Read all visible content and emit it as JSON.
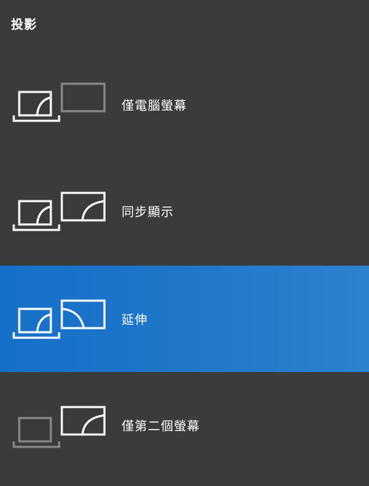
{
  "header": {
    "title": "投影"
  },
  "options": [
    {
      "label": "僅電腦螢幕",
      "icon": "pc-screen-only-icon",
      "selected": false
    },
    {
      "label": "同步顯示",
      "icon": "duplicate-icon",
      "selected": false
    },
    {
      "label": "延伸",
      "icon": "extend-icon",
      "selected": true
    },
    {
      "label": "僅第二個螢幕",
      "icon": "second-screen-only-icon",
      "selected": false
    }
  ],
  "colors": {
    "background": "#3b3b3b",
    "selected": "#1a73c9",
    "icon_active": "#ffffff",
    "icon_inactive": "#8a8a8a"
  }
}
